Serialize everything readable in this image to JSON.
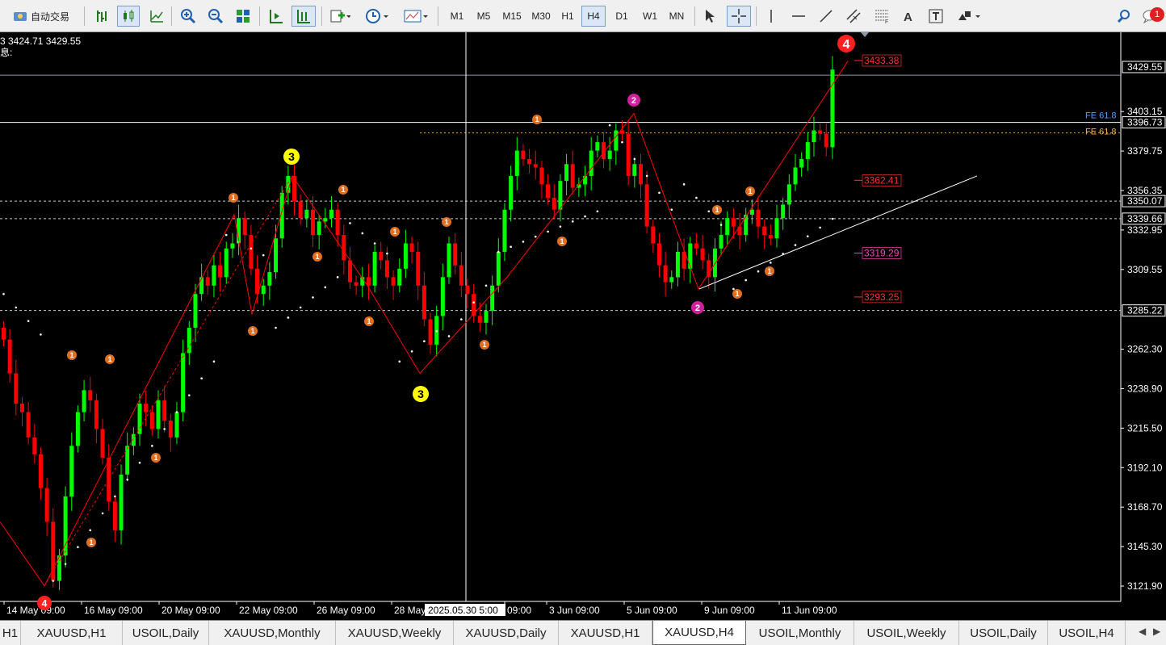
{
  "toolbar": {
    "auto_trade_label": "自动交易",
    "timeframes": [
      "M1",
      "M5",
      "M15",
      "M30",
      "H1",
      "H4",
      "D1",
      "W1",
      "MN"
    ],
    "active_timeframe": "H4",
    "notification_count": "1",
    "icons": [
      "bar-chart-icon",
      "candle-chart-icon",
      "line-chart-icon",
      "zoom-in-icon",
      "zoom-out-icon",
      "tile-windows-icon",
      "autoscroll-icon",
      "chart-shift-icon",
      "new-order-icon",
      "clock-icon",
      "templates-icon",
      "cursor-icon",
      "crosshair-icon",
      "vertical-line-icon",
      "horizontal-line-icon",
      "trend-line-icon",
      "equidistant-channel-icon",
      "fibonacci-icon",
      "text-icon",
      "text-label-icon",
      "shapes-icon",
      "search-icon",
      "chat-icon"
    ]
  },
  "chart": {
    "info_line1": "3 3424.71 3429.55",
    "info_line2": "息:",
    "price_axis": [
      "3429.55",
      "3403.15",
      "3396.73",
      "3379.75",
      "3356.35",
      "3350.07",
      "3339.66",
      "3332.95",
      "3309.55",
      "3285.22",
      "3262.30",
      "3238.90",
      "3215.50",
      "3192.10",
      "3168.70",
      "3145.30",
      "3121.90"
    ],
    "time_axis": [
      "14 May 09:00",
      "16 May 09:00",
      "20 May 09:00",
      "22 May 09:00",
      "26 May 09:00",
      "28 May",
      "2025.05.30 5:00",
      "09:00",
      "3 Jun 09:00",
      "5 Jun 09:00",
      "9 Jun 09:00",
      "11 Jun 09:00"
    ],
    "level_labels": [
      "3433.38",
      "3362.41",
      "3319.29",
      "3293.25"
    ],
    "fe_label_blue": "FE 61.8",
    "fe_label_orange": "FE 61.8",
    "wave_labels": {
      "big4": "4",
      "yellow3": "3",
      "magenta2": "2",
      "small1": "1"
    },
    "colors": {
      "bull": "#00ff00",
      "bear": "#ff0000",
      "wave_line": "#ff0000",
      "orange_label": "#e07020",
      "magenta_label": "#d020a0",
      "yellow_label": "#ffff00",
      "level_red": "#ff3030",
      "level_magenta": "#ff40c0"
    }
  },
  "tabs": {
    "items": [
      "H1",
      "XAUUSD,H1",
      "USOIL,Daily",
      "XAUUSD,Monthly",
      "XAUUSD,Weekly",
      "XAUUSD,Daily",
      "XAUUSD,H1",
      "XAUUSD,H4",
      "USOIL,Monthly",
      "USOIL,Weekly",
      "USOIL,Daily",
      "USOIL,H4"
    ],
    "active_index": 7
  }
}
